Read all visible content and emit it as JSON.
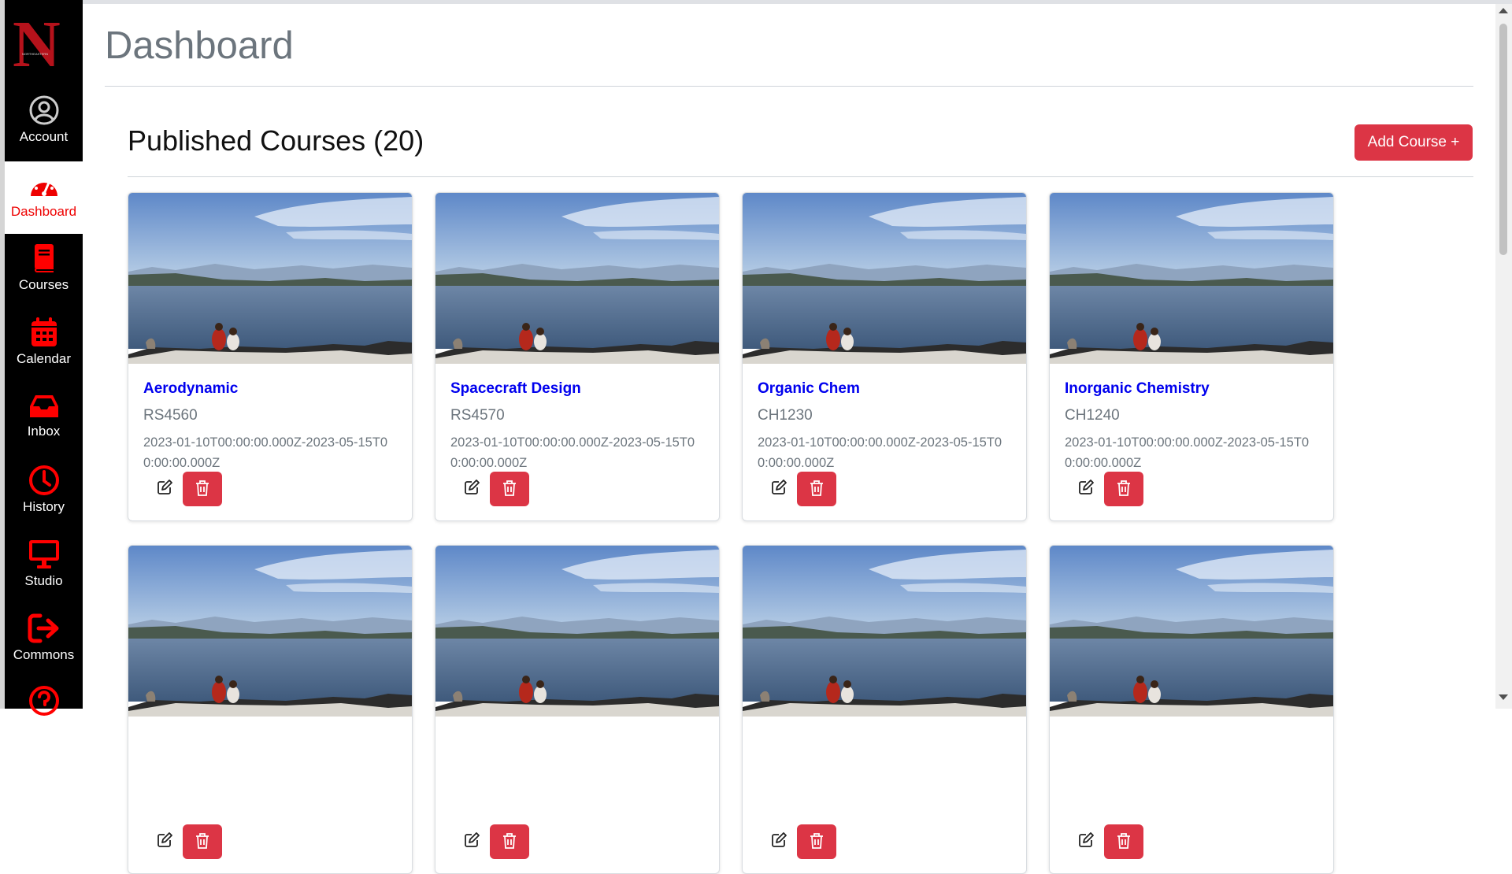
{
  "sidebar": {
    "logo_icon": "university-n-logo-icon",
    "items": [
      {
        "label": "Account",
        "icon": "user-circle-icon"
      },
      {
        "label": "Dashboard",
        "icon": "speedometer-icon",
        "active": true
      },
      {
        "label": "Courses",
        "icon": "book-icon"
      },
      {
        "label": "Calendar",
        "icon": "calendar-icon"
      },
      {
        "label": "Inbox",
        "icon": "inbox-tray-icon"
      },
      {
        "label": "History",
        "icon": "clock-icon"
      },
      {
        "label": "Studio",
        "icon": "monitor-icon"
      },
      {
        "label": "Commons",
        "icon": "sign-out-arrow-icon"
      }
    ],
    "partial_icon": "help-circle-icon"
  },
  "page": {
    "title": "Dashboard"
  },
  "section": {
    "title": "Published Courses (20)",
    "add_button_label": "Add Course +"
  },
  "courses": [
    {
      "title": "Aerodynamic",
      "code": "RS4560",
      "dates": "2023-01-10T00:00:00.000Z-2023-05-15T00:00:00.000Z"
    },
    {
      "title": "Spacecraft Design",
      "code": "RS4570",
      "dates": "2023-01-10T00:00:00.000Z-2023-05-15T00:00:00.000Z"
    },
    {
      "title": "Organic Chem",
      "code": "CH1230",
      "dates": "2023-01-10T00:00:00.000Z-2023-05-15T00:00:00.000Z"
    },
    {
      "title": "Inorganic Chemistry",
      "code": "CH1240",
      "dates": "2023-01-10T00:00:00.000Z-2023-05-15T00:00:00.000Z"
    }
  ],
  "card_icons": {
    "edit": "pencil-edit-icon",
    "delete": "trash-icon"
  },
  "colors": {
    "accent": "#dc3545",
    "sidebar_bg": "#000000",
    "active_label": "#ee0000",
    "icon_red": "#ff0000",
    "link": "#0000ee",
    "muted": "#6c757d"
  }
}
